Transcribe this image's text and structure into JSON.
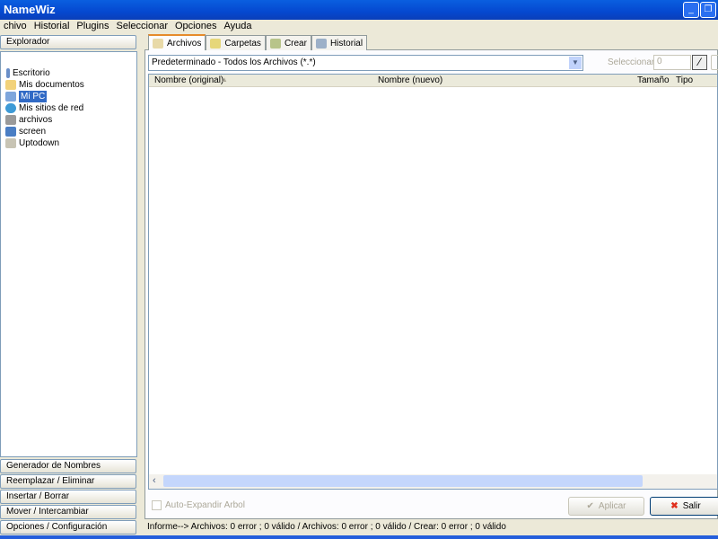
{
  "window": {
    "title": "NameWiz"
  },
  "menu": [
    "chivo",
    "Historial",
    "Plugins",
    "Seleccionar",
    "Opciones",
    "Ayuda"
  ],
  "left": {
    "explorer_label": "Explorador",
    "tree": [
      {
        "label": "Escritorio",
        "icon": "desktop-icon"
      },
      {
        "label": "Mis documentos",
        "icon": "folder-icon"
      },
      {
        "label": "Mi PC",
        "icon": "computer-icon",
        "selected": true
      },
      {
        "label": "Mis sitios de red",
        "icon": "network-icon"
      },
      {
        "label": "archivos",
        "icon": "drive-icon"
      },
      {
        "label": "screen",
        "icon": "monitor-icon"
      },
      {
        "label": "Uptodown",
        "icon": "book-icon"
      }
    ],
    "modules": [
      "Generador de Nombres",
      "Reemplazar / Eliminar",
      "Insertar / Borrar",
      "Mover / Intercambiar",
      "Opciones / Configuración"
    ]
  },
  "tabs": [
    "Archivos",
    "Carpetas",
    "Crear",
    "Historial"
  ],
  "filter": {
    "value": "Predeterminado - Todos los Archivos (*.*)",
    "select_label": "Seleccionar",
    "select_value": "0"
  },
  "columns": [
    "Nombre (original)",
    "Nombre (nuevo)",
    "Tamaño",
    "Tipo"
  ],
  "auto_expand": "Auto-Expandir Arbol",
  "apply": "Aplicar",
  "exit": "Salir",
  "status": "Informe--> Archivos: 0 error ; 0 válido  /  Archivos: 0 error ; 0 válido  /  Crear: 0 error ; 0 válido",
  "colors": {
    "titlebar": "#0548d0",
    "selection": "#316ac5",
    "tab_accent": "#e68b2c"
  }
}
